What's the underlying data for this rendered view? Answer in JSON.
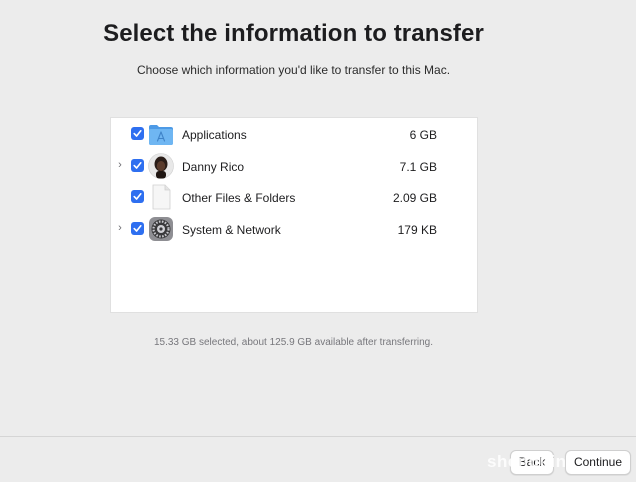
{
  "header": {
    "title": "Select the information to transfer",
    "subtitle": "Choose which information you'd like to transfer to this Mac."
  },
  "items": [
    {
      "label": "Applications",
      "size": "6 GB",
      "checked": true,
      "expandable": false,
      "icon": "applications-folder-icon"
    },
    {
      "label": "Danny Rico",
      "size": "7.1 GB",
      "checked": true,
      "expandable": true,
      "icon": "user-avatar-icon"
    },
    {
      "label": "Other Files & Folders",
      "size": "2.09 GB",
      "checked": true,
      "expandable": false,
      "icon": "document-icon"
    },
    {
      "label": "System & Network",
      "size": "179 KB",
      "checked": true,
      "expandable": true,
      "icon": "system-settings-gear-icon"
    }
  ],
  "summary": "15.33 GB selected, about 125.9 GB available after transferring.",
  "buttons": {
    "back": "Back",
    "continue": "Continue"
  },
  "watermark": "shenduin",
  "colors": {
    "checkbox": "#2e6ff0",
    "background": "#ececec",
    "panel": "#ffffff",
    "folder": "#5ba7ec"
  }
}
